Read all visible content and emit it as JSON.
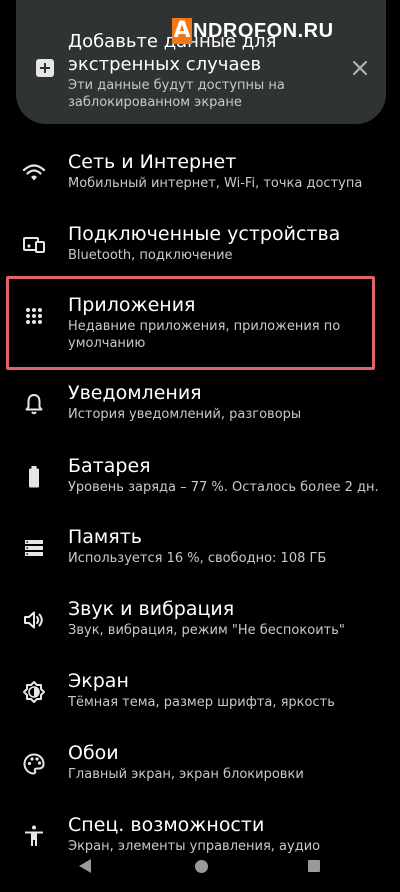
{
  "watermark": {
    "letter": "A",
    "text": "NDROFON.RU"
  },
  "emergency_card": {
    "title": "Добавьте данные для экстренных случаев",
    "subtitle": "Эти данные будут доступны на заблокированном экране"
  },
  "settings": [
    {
      "title": "Сеть и Интернет",
      "subtitle": "Мобильный интернет, Wi-Fi, точка доступа",
      "icon": "wifi-icon"
    },
    {
      "title": "Подключенные устройства",
      "subtitle": "Bluetooth, подключение",
      "icon": "devices-icon"
    },
    {
      "title": "Приложения",
      "subtitle": "Недавние приложения, приложения по умолчанию",
      "icon": "apps-grid-icon"
    },
    {
      "title": "Уведомления",
      "subtitle": "История уведомлений, разговоры",
      "icon": "bell-icon"
    },
    {
      "title": "Батарея",
      "subtitle": "Уровень заряда – 77 %. Осталось более 2 дн.",
      "icon": "battery-icon"
    },
    {
      "title": "Память",
      "subtitle": "Используется 16 %, свободно: 108 ГБ",
      "icon": "storage-icon"
    },
    {
      "title": "Звук и вибрация",
      "subtitle": "Звук, вибрация, режим \"Не беспокоить\"",
      "icon": "volume-icon"
    },
    {
      "title": "Экран",
      "subtitle": "Тёмная тема, размер шрифта, яркость",
      "icon": "brightness-icon"
    },
    {
      "title": "Обои",
      "subtitle": "Главный экран, экран блокировки",
      "icon": "palette-icon"
    },
    {
      "title": "Спец. возможности",
      "subtitle": "Экран, элементы управления, аудио",
      "icon": "accessibility-icon"
    }
  ],
  "colors": {
    "highlight": "#e0636a",
    "card_bg": "#2f3333",
    "watermark_accent": "#f07a1a"
  }
}
